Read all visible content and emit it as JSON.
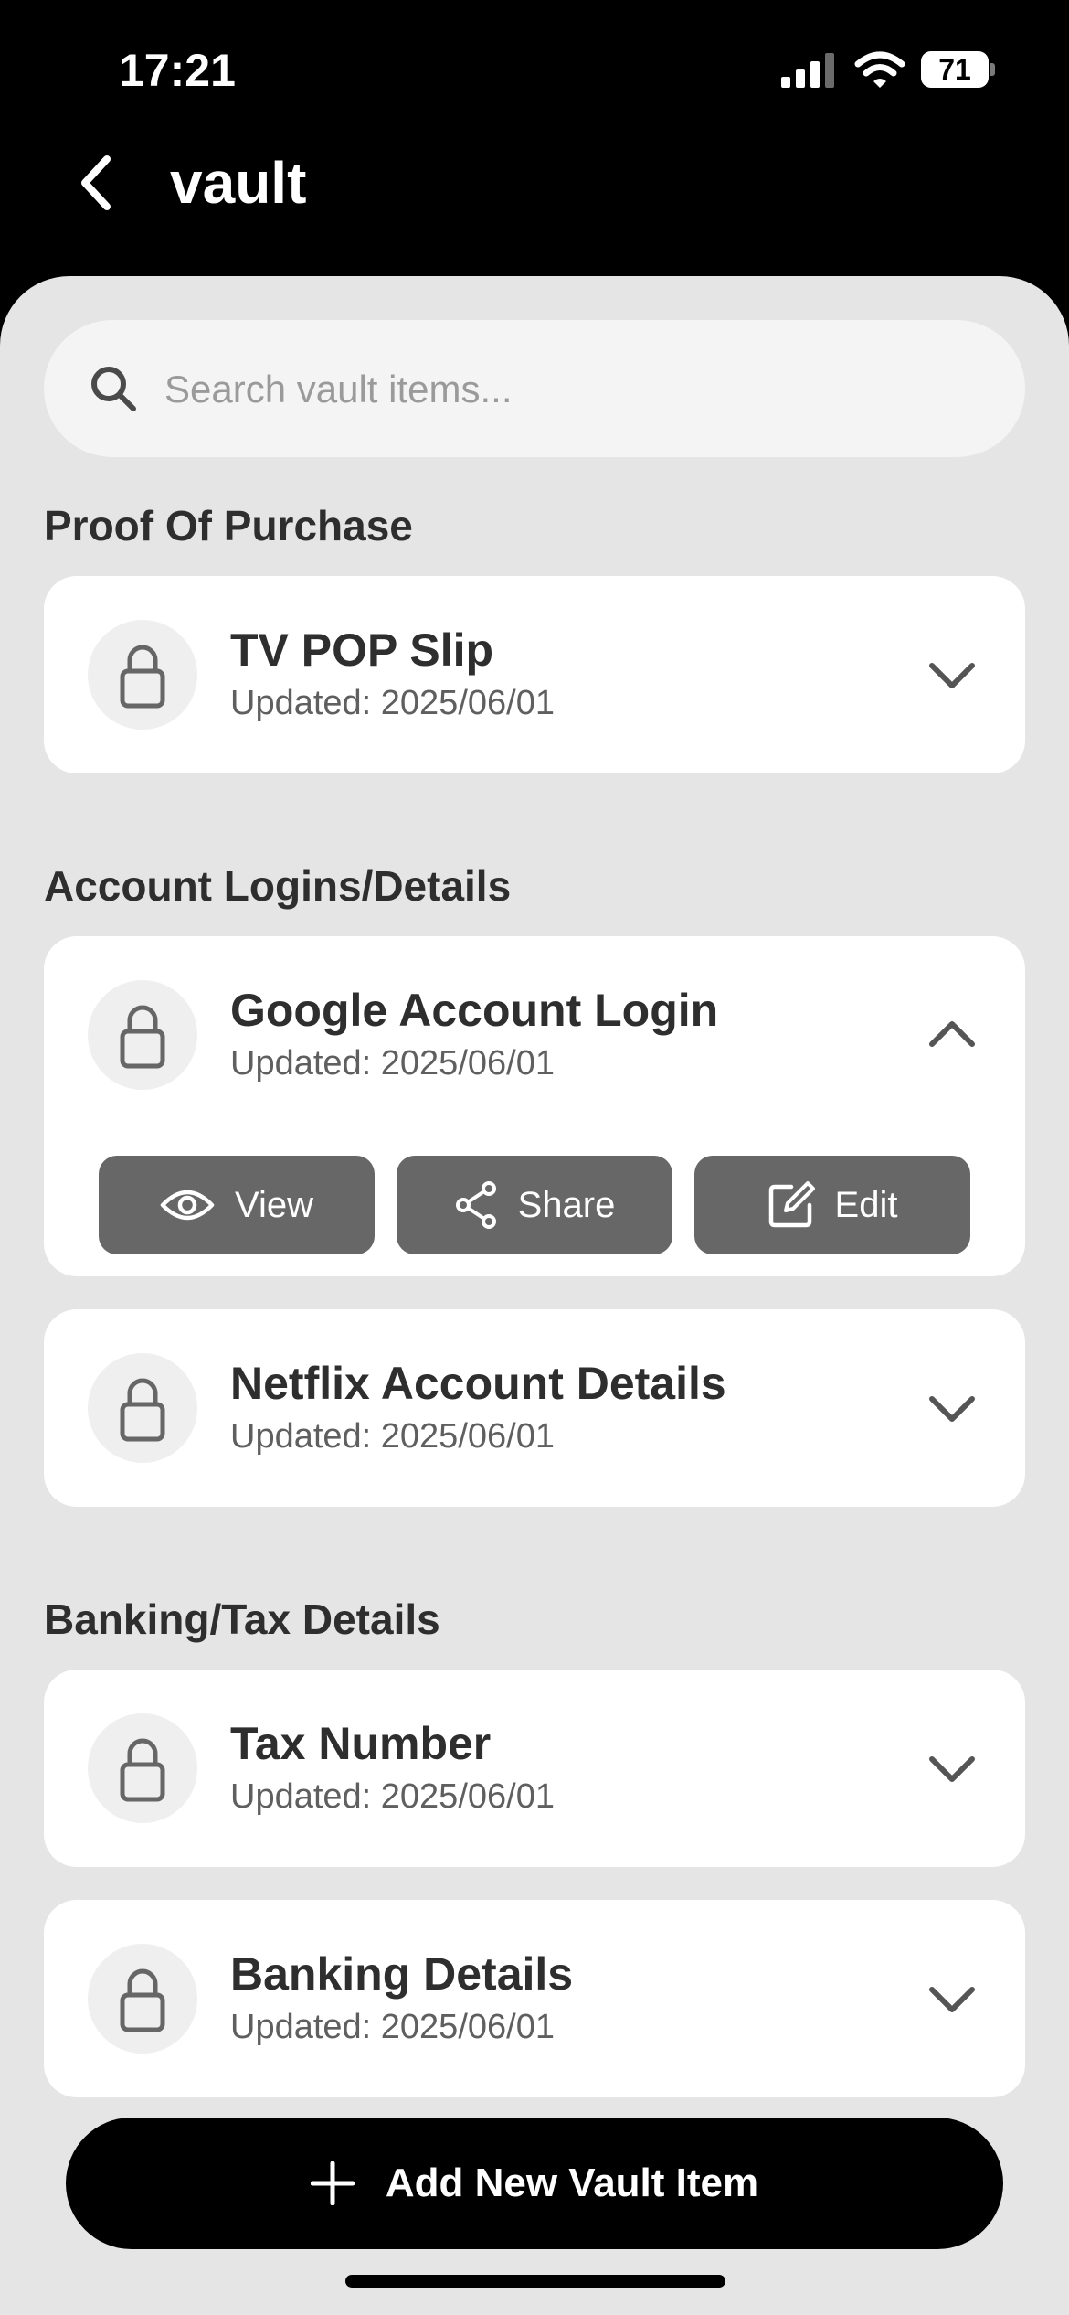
{
  "status_bar": {
    "time": "17:21",
    "battery": "71"
  },
  "header": {
    "title": "vault"
  },
  "search": {
    "placeholder": "Search vault items..."
  },
  "sections": [
    {
      "title": "Proof Of Purchase",
      "items": [
        {
          "title": "TV POP Slip",
          "subtitle": "Updated: 2025/06/01",
          "expanded": false
        }
      ]
    },
    {
      "title": "Account Logins/Details",
      "items": [
        {
          "title": "Google Account Login",
          "subtitle": "Updated: 2025/06/01",
          "expanded": true,
          "actions": {
            "view": "View",
            "share": "Share",
            "edit": "Edit"
          }
        },
        {
          "title": "Netflix Account Details",
          "subtitle": "Updated: 2025/06/01",
          "expanded": false
        }
      ]
    },
    {
      "title": "Banking/Tax Details",
      "items": [
        {
          "title": "Tax Number",
          "subtitle": "Updated: 2025/06/01",
          "expanded": false
        },
        {
          "title": "Banking Details",
          "subtitle": "Updated: 2025/06/01",
          "expanded": false
        }
      ]
    }
  ],
  "add_button": {
    "label": "Add New Vault Item"
  },
  "icons": {
    "back": "chevron-left-icon",
    "search": "search-icon",
    "lock": "lock-icon",
    "expand": "chevron-down-icon",
    "collapse": "chevron-up-icon",
    "view": "eye-icon",
    "share": "share-icon",
    "edit": "edit-icon",
    "add": "plus-icon"
  },
  "colors": {
    "header_bg": "#000000",
    "sheet_bg": "#e5e5e5",
    "card_bg": "#ffffff",
    "action_bg": "#676767"
  }
}
